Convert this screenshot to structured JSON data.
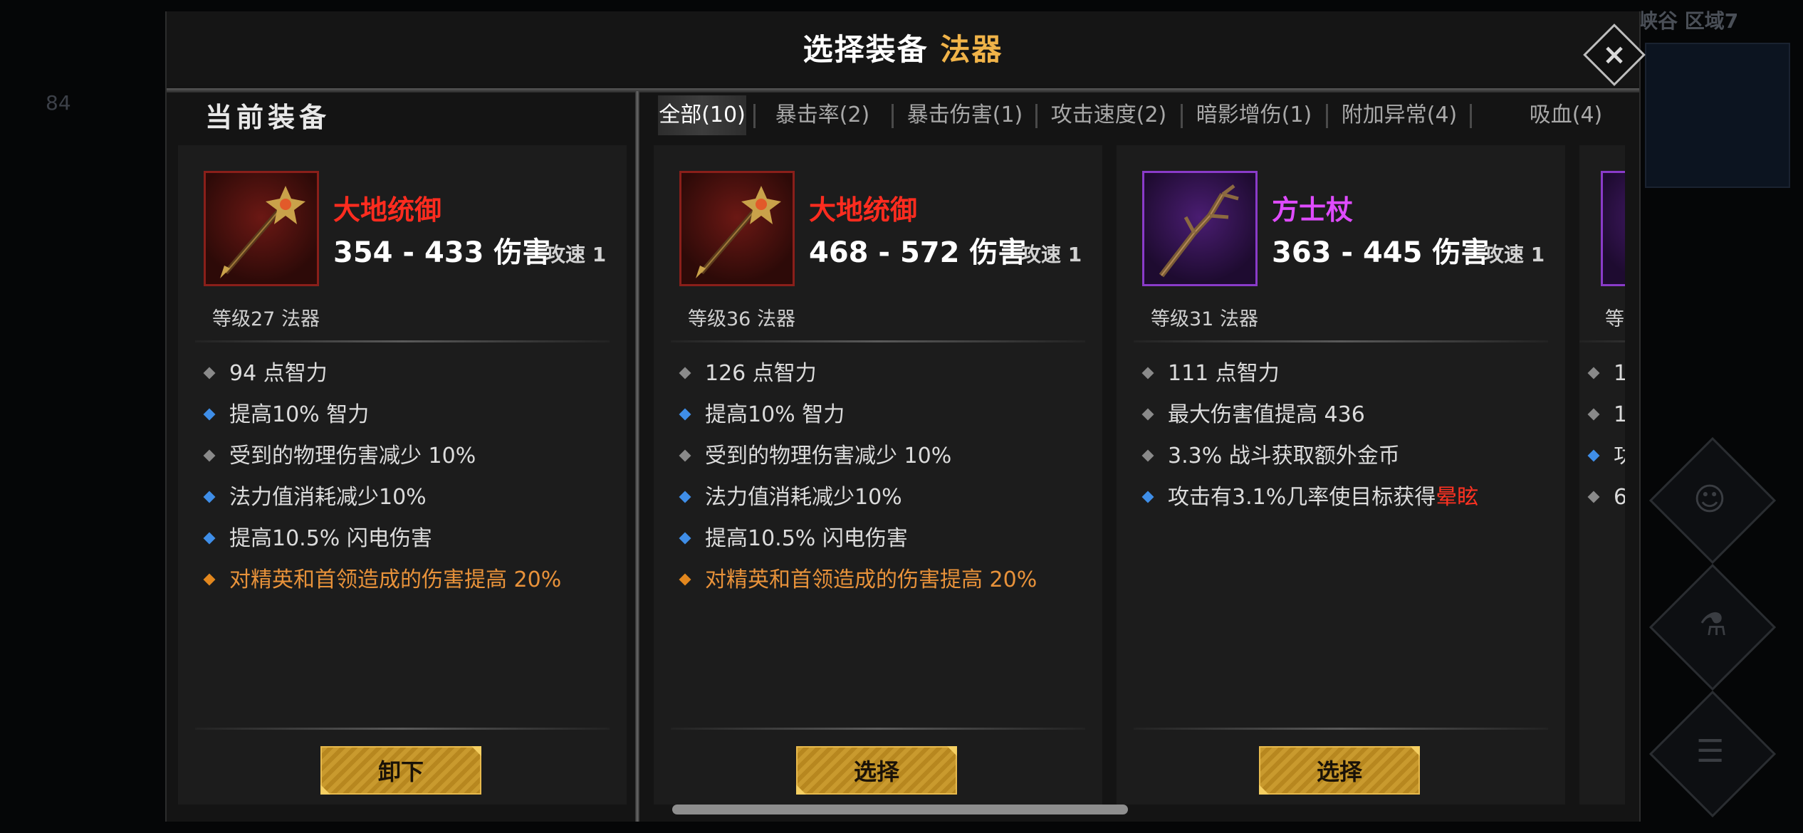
{
  "background": {
    "region_text": "峡谷 区域7",
    "side_number": "84"
  },
  "dialog": {
    "title_prefix": "选择装备",
    "title_accent": "法器",
    "close_label": "×"
  },
  "current_section_label": "当前装备",
  "tabs": [
    {
      "label": "全部(10)",
      "active": true
    },
    {
      "label": "暴击率(2)",
      "active": false
    },
    {
      "label": "暴击伤害(1)",
      "active": false
    },
    {
      "label": "攻击速度(2)",
      "active": false
    },
    {
      "label": "暗影增伤(1)",
      "active": false
    },
    {
      "label": "附加异常(4)",
      "active": false
    },
    {
      "label": "吸血(4)",
      "active": false
    }
  ],
  "cards": [
    {
      "name": "大地统御",
      "rarity_color": "#ff2c1f",
      "damage": "354 - 433 伤害",
      "speed": "攻速 1",
      "level": "等级27 法器",
      "icon": "staff-icon",
      "stats": [
        {
          "text": "94 点智力",
          "bullet": "gray"
        },
        {
          "text": "提高10% 智力",
          "bullet": "blue"
        },
        {
          "text": "受到的物理伤害减少 10%",
          "bullet": "gray"
        },
        {
          "text": "法力值消耗减少10%",
          "bullet": "blue"
        },
        {
          "text": "提高10.5% 闪电伤害",
          "bullet": "blue"
        },
        {
          "text": "对精英和首领造成的伤害提高 20%",
          "bullet": "orange"
        }
      ],
      "button": "卸下"
    },
    {
      "name": "大地统御",
      "rarity_color": "#ff2c1f",
      "damage": "468 - 572 伤害",
      "speed": "攻速 1",
      "level": "等级36 法器",
      "icon": "staff-icon",
      "stats": [
        {
          "text": "126 点智力",
          "bullet": "gray"
        },
        {
          "text": "提高10% 智力",
          "bullet": "blue"
        },
        {
          "text": "受到的物理伤害减少 10%",
          "bullet": "gray"
        },
        {
          "text": "法力值消耗减少10%",
          "bullet": "blue"
        },
        {
          "text": "提高10.5% 闪电伤害",
          "bullet": "blue"
        },
        {
          "text": "对精英和首领造成的伤害提高 20%",
          "bullet": "orange"
        }
      ],
      "button": "选择"
    },
    {
      "name": "方士杖",
      "rarity_color": "#df4bff",
      "damage": "363 - 445 伤害",
      "speed": "攻速 1",
      "level": "等级31 法器",
      "icon": "wooden-staff-icon",
      "stats": [
        {
          "text": "111 点智力",
          "bullet": "gray"
        },
        {
          "text": "最大伤害值提高 436",
          "bullet": "gray"
        },
        {
          "text": "3.3% 战斗获取额外金币",
          "bullet": "gray"
        },
        {
          "text": "攻击有3.1%几率使目标获得",
          "highlight": "晕眩",
          "bullet": "blue"
        }
      ],
      "button": "选择"
    },
    {
      "name": "",
      "level_partial": "等",
      "stats_partial": [
        "1",
        "1",
        "功",
        "6"
      ]
    }
  ]
}
